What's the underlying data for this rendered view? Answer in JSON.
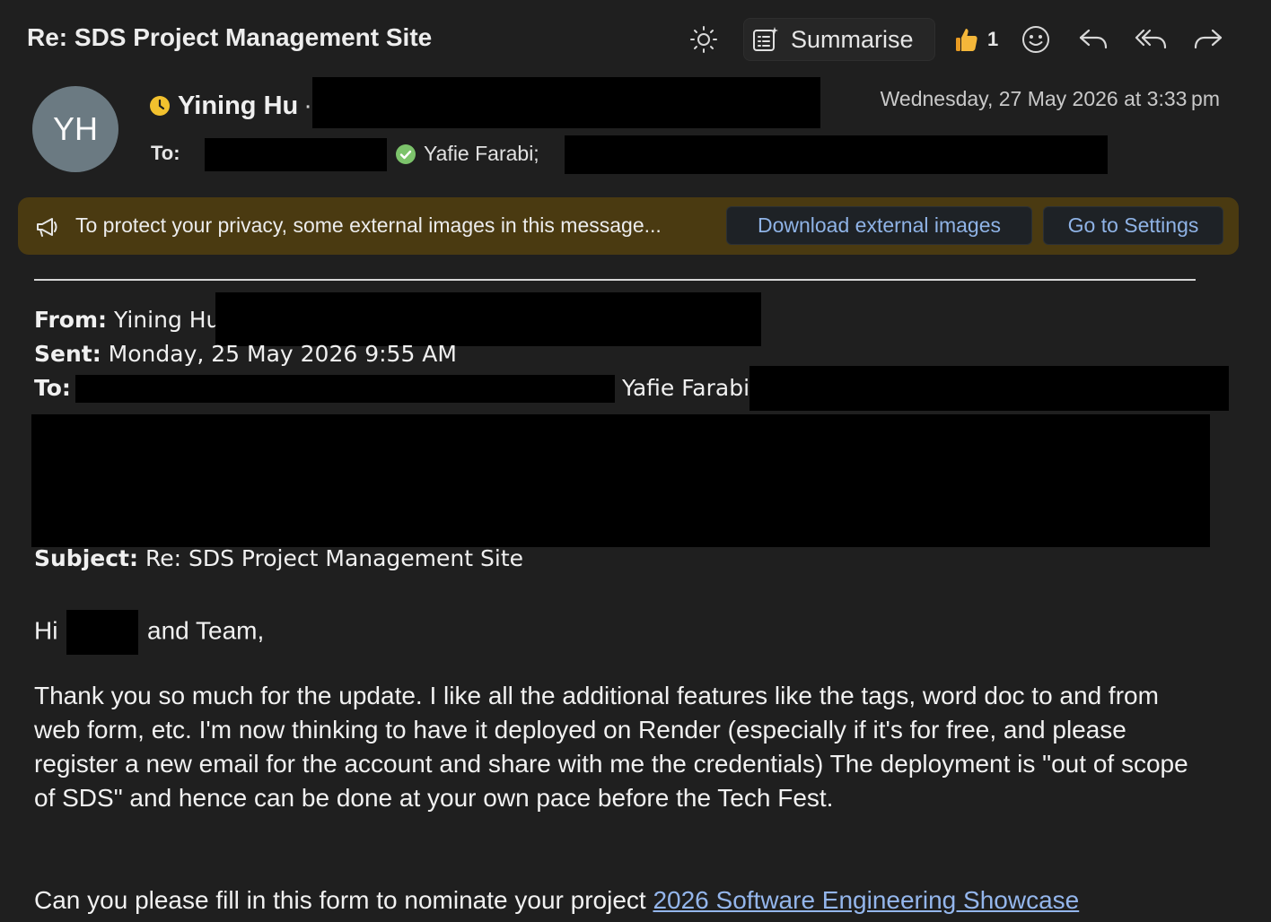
{
  "header": {
    "title": "Re: SDS Project Management Site",
    "summarise_label": "Summarise",
    "like_count": "1"
  },
  "sender": {
    "initials": "YH",
    "name": "Yining Hu",
    "date": "Wednesday, 27 May 2026 at 3:33 pm",
    "to_label": "To:",
    "recipient_name": "Yafie Farabi;"
  },
  "banner": {
    "message": "To protect your privacy, some external images in this message...",
    "download_label": "Download external images",
    "settings_label": "Go to Settings"
  },
  "quoted": {
    "from_label": "From:",
    "from_value": "Yining Hu",
    "sent_label": "Sent:",
    "sent_value": "Monday, 25 May 2026 9:55 AM",
    "to_label": "To:",
    "to_value": "Yafie Farabi",
    "subject_label": "Subject:",
    "subject_value": "Re: SDS Project Management Site"
  },
  "body": {
    "greeting_start": "Hi",
    "greeting_end": "and Team,",
    "paragraph1": "Thank you so much for the update. I like all the additional features like the tags, word doc to and from web form, etc. I'm now thinking to have it deployed on Render (especially if it's for free, and please register a new email for the account and share with me the credentials) The deployment is \"out of scope of SDS\" and hence can be done at your own pace before the Tech Fest.",
    "paragraph2_start": "Can you please fill in this form to nominate your project ",
    "link_text": "2026 Software Engineering Showcase"
  },
  "colors": {
    "background": "#1f1f1f",
    "banner": "#4a3a11",
    "link": "#94b6ec",
    "status_away": "#f2c12e",
    "status_available": "#7cc36b"
  },
  "icons": [
    "sun-icon",
    "summarise-icon",
    "thumbs-up-icon",
    "emoji-icon",
    "reply-icon",
    "reply-all-icon",
    "forward-icon",
    "clock-status-icon",
    "check-status-icon",
    "megaphone-icon"
  ]
}
